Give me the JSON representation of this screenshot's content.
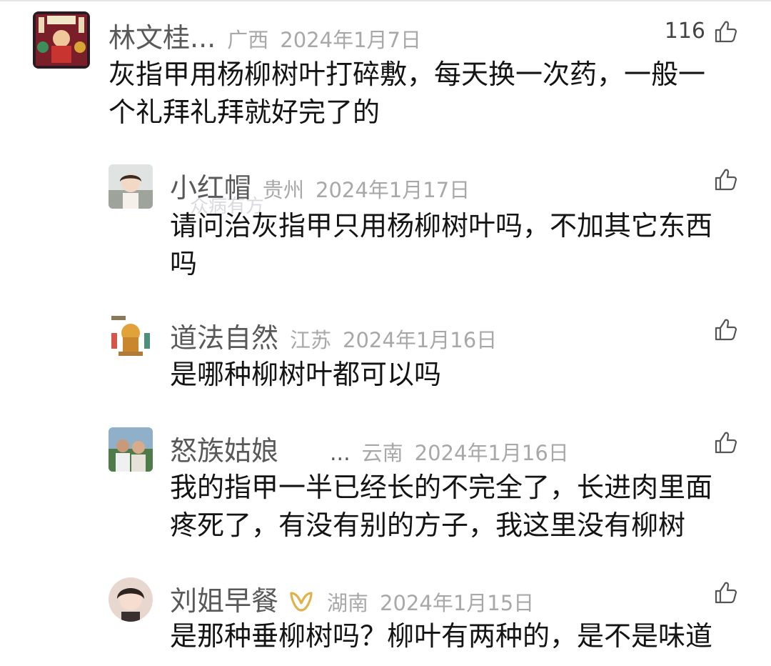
{
  "comments": [
    {
      "name": "林文桂...",
      "region": "广西",
      "date": "2024年1月7日",
      "likes": "116",
      "lines": [
        "灰指甲用杨柳树叶打碎敷，每天换一次药，一般一",
        "个礼拜礼拜就好完了的"
      ]
    },
    {
      "name": "小红帽",
      "region": "贵州",
      "date": "2024年1月17日",
      "watermark": "众病有方",
      "lines": [
        "请问治灰指甲只用杨柳树叶吗，不加其它东西",
        "吗"
      ]
    },
    {
      "name": "道法自然",
      "region": "江苏",
      "date": "2024年1月16日",
      "lines": [
        "是哪种柳树叶都可以吗"
      ]
    },
    {
      "name": "怒族姑娘",
      "ellipsis": "...",
      "region": "云南",
      "date": "2024年1月16日",
      "lines": [
        "我的指甲一半已经长的不完全了，长进肉里面",
        "疼死了，有没有别的方子，我这里没有柳树"
      ]
    },
    {
      "name": "刘姐早餐",
      "region": "湖南",
      "date": "2024年1月15日",
      "badge": "gold-ribbon-badge-icon",
      "lines": [
        "是那种垂柳树吗？柳叶有两种的，是不是味道"
      ]
    }
  ],
  "colors": {
    "name": "#595959",
    "meta": "#a8a8a8",
    "text": "#141414",
    "badge": "#e0b24a"
  }
}
